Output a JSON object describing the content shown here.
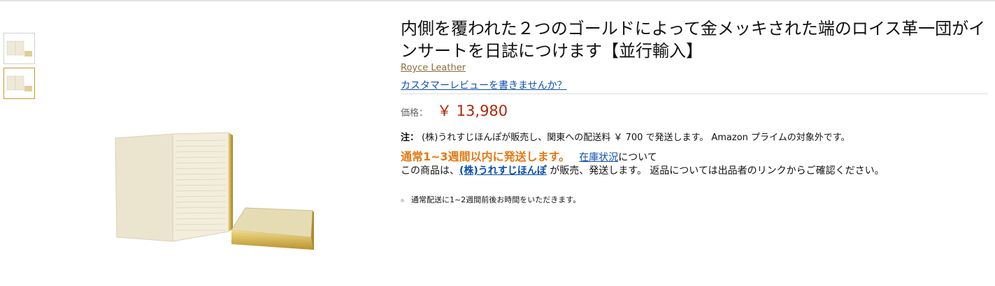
{
  "product": {
    "title": "内側を覆われた２つのゴールドによって金メッキされた端のロイス革一団がインサートを日誌につけます【並行輸入】",
    "brand": "Royce Leather",
    "review_link": "カスタマーレビューを書きませんか？"
  },
  "price": {
    "label": "価格：",
    "value": "￥ 13,980"
  },
  "note": {
    "label": "注：",
    "text": "(株)うれすじほんぽが販売し、関東への配送料 ￥ 700 で発送します。  Amazon プライムの対象外です。"
  },
  "availability": {
    "status": "通常1~3週間以内に発送します。",
    "stock_link": "在庫状況",
    "stock_suffix": "について"
  },
  "seller": {
    "prefix": "この商品は、",
    "name": "(株)うれすじほんぽ",
    "suffix": " が販売、発送します。 返品については出品者のリンクからご確認ください。"
  },
  "bullets": [
    "通常配送に1~2週間前後お時間をいただきます。"
  ],
  "thumbnails": [
    {
      "icon": "journal-thumbnail-1",
      "selected": false
    },
    {
      "icon": "journal-thumbnail-2",
      "selected": true
    }
  ],
  "colors": {
    "price": "#b12704",
    "availability": "#e47911",
    "link": "#0b4fb0",
    "brand": "#8a6d3b",
    "selected_thumb_border": "#c7972b"
  }
}
